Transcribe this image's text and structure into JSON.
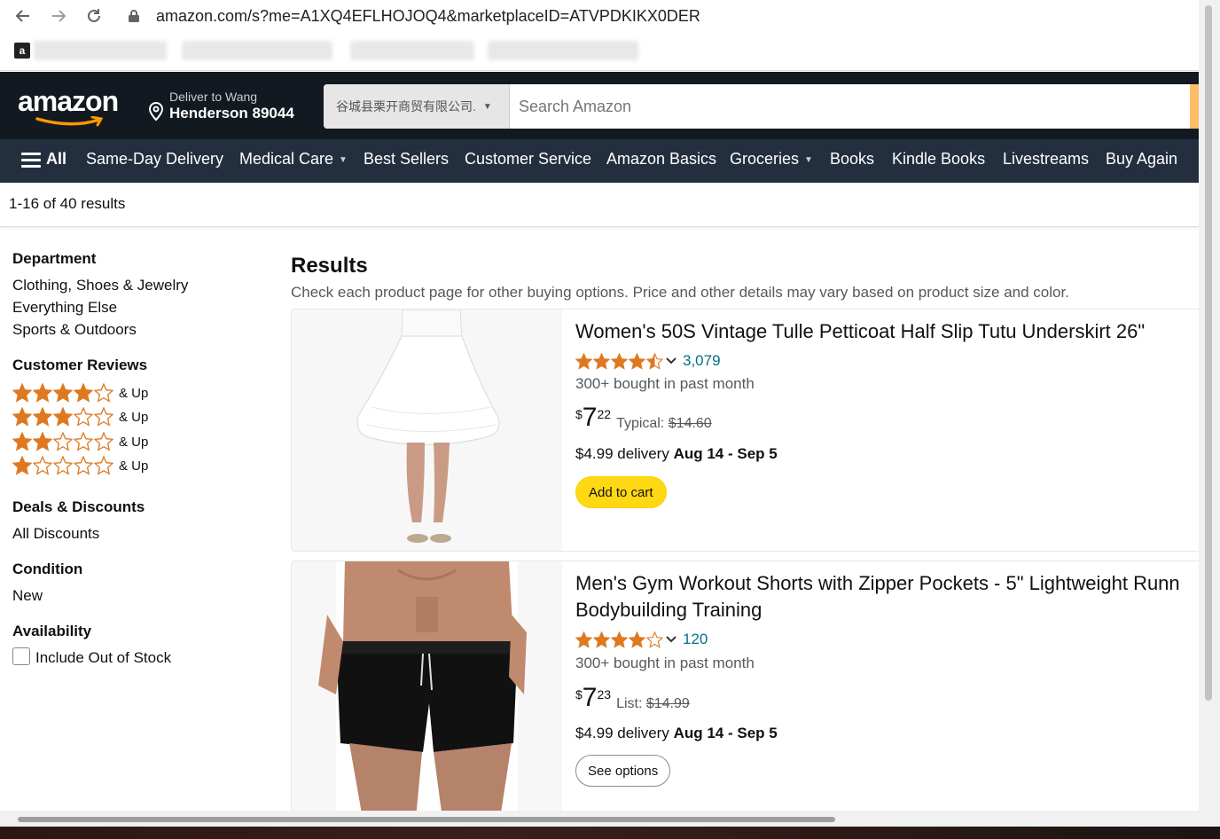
{
  "browser": {
    "url": "amazon.com/s?me=A1XQ4EFLHOJOQ4&marketplaceID=ATVPDKIKX0DER"
  },
  "header": {
    "logo_text": "amazon",
    "deliver_to": "Deliver to Wang",
    "location": "Henderson 89044",
    "search_department": "谷城县栗开商贸有限公司.",
    "search_placeholder": "Search Amazon"
  },
  "nav": {
    "all_label": "All",
    "items": [
      {
        "label": "Same-Day Delivery"
      },
      {
        "label": "Medical Care"
      },
      {
        "label": "Best Sellers"
      },
      {
        "label": "Customer Service"
      },
      {
        "label": "Amazon Basics"
      },
      {
        "label": "Groceries"
      },
      {
        "label": "Books"
      },
      {
        "label": "Kindle Books"
      },
      {
        "label": "Livestreams"
      },
      {
        "label": "Buy Again"
      }
    ]
  },
  "results_count": "1-16 of 40 results",
  "sidebar": {
    "department_heading": "Department",
    "departments": [
      "Clothing, Shoes & Jewelry",
      "Everything Else",
      "Sports & Outdoors"
    ],
    "reviews_heading": "Customer Reviews",
    "review_filters": [
      {
        "stars": 4,
        "label": "& Up"
      },
      {
        "stars": 3,
        "label": "& Up"
      },
      {
        "stars": 2,
        "label": "& Up"
      },
      {
        "stars": 1,
        "label": "& Up"
      }
    ],
    "deals_heading": "Deals & Discounts",
    "deals_link": "All Discounts",
    "condition_heading": "Condition",
    "condition_link": "New",
    "availability_heading": "Availability",
    "availability_option": "Include Out of Stock"
  },
  "results": {
    "title": "Results",
    "subtitle": "Check each product page for other buying options. Price and other details may vary based on product size and color.",
    "products": [
      {
        "title": "Women's 50S Vintage Tulle Petticoat Half Slip Tutu Underskirt 26\"",
        "rating": 4.5,
        "review_count": "3,079",
        "bought": "300+ bought in past month",
        "price_symbol": "$",
        "price_whole": "7",
        "price_fraction": "22",
        "compare_label": "Typical:",
        "compare_price": "$14.60",
        "delivery_prefix": "$4.99 delivery",
        "delivery_dates": "Aug 14 - Sep 5",
        "button": "Add to cart"
      },
      {
        "title_line1": "Men's Gym Workout Shorts with Zipper Pockets - 5\" Lightweight Runn",
        "title_line2": "Bodybuilding Training",
        "rating": 4.0,
        "review_count": "120",
        "bought": "300+ bought in past month",
        "price_symbol": "$",
        "price_whole": "7",
        "price_fraction": "23",
        "compare_label": "List:",
        "compare_price": "$14.99",
        "delivery_prefix": "$4.99 delivery",
        "delivery_dates": "Aug 14 - Sep 5",
        "button": "See options"
      }
    ]
  },
  "colors": {
    "header_bg": "#131921",
    "nav_bg": "#232f3e",
    "star": "#de7921",
    "link": "#007185",
    "cart_button": "#ffd814"
  }
}
